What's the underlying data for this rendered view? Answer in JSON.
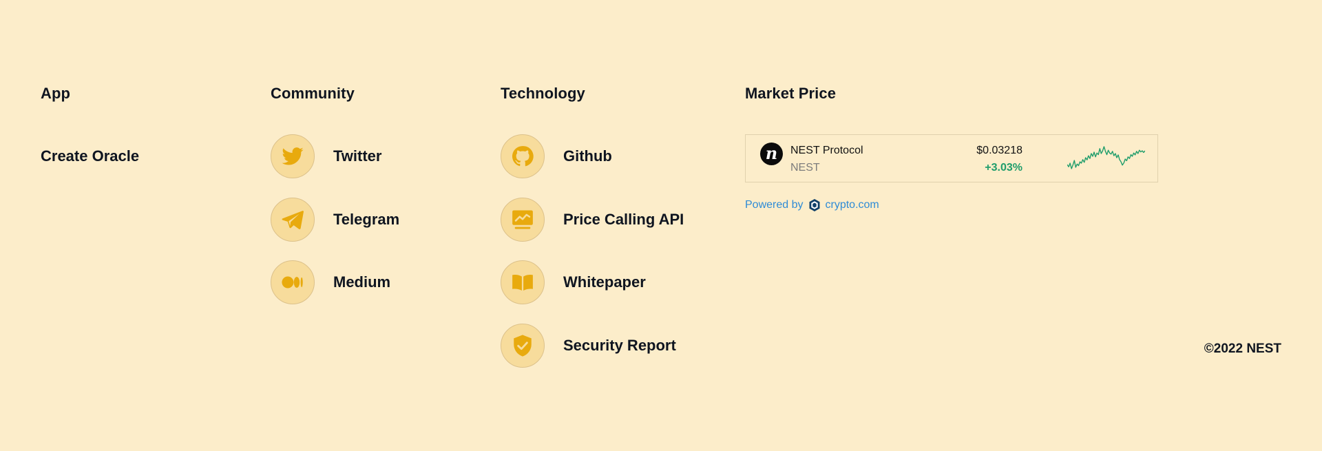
{
  "app": {
    "heading": "App",
    "link": "Create Oracle"
  },
  "community": {
    "heading": "Community",
    "items": [
      {
        "label": "Twitter",
        "icon": "twitter-icon"
      },
      {
        "label": "Telegram",
        "icon": "telegram-icon"
      },
      {
        "label": "Medium",
        "icon": "medium-icon"
      }
    ]
  },
  "technology": {
    "heading": "Technology",
    "items": [
      {
        "label": "Github",
        "icon": "github-icon"
      },
      {
        "label": "Price Calling API",
        "icon": "chart-monitor-icon"
      },
      {
        "label": "Whitepaper",
        "icon": "book-icon"
      },
      {
        "label": "Security Report",
        "icon": "shield-check-icon"
      }
    ]
  },
  "market": {
    "heading": "Market Price",
    "coin": {
      "logo_letter": "n",
      "name": "NEST Protocol",
      "symbol": "NEST",
      "price": "$0.03218",
      "change": "+3.03%"
    },
    "powered_by_text": "Powered by",
    "powered_by_link": "crypto.com",
    "sparkline": [
      0.3,
      0.22,
      0.35,
      0.15,
      0.28,
      0.45,
      0.2,
      0.32,
      0.26,
      0.4,
      0.35,
      0.48,
      0.38,
      0.55,
      0.47,
      0.62,
      0.52,
      0.7,
      0.6,
      0.75,
      0.58,
      0.72,
      0.66,
      0.88,
      0.7,
      0.8,
      0.95,
      0.78,
      0.66,
      0.82,
      0.72,
      0.68,
      0.78,
      0.62,
      0.7,
      0.55,
      0.65,
      0.48,
      0.4,
      0.28,
      0.36,
      0.5,
      0.44,
      0.58,
      0.52,
      0.66,
      0.6,
      0.72,
      0.65,
      0.78,
      0.7,
      0.82,
      0.76,
      0.8,
      0.74,
      0.8
    ]
  },
  "footer": {
    "copyright": "©2022 NEST"
  },
  "colors": {
    "background": "#fcedca",
    "icon_circle": "#f7dc9c",
    "icon_fill": "#e8aa0e",
    "text": "#0f1520",
    "positive": "#1f9d6b",
    "link": "#2e8bd6"
  }
}
